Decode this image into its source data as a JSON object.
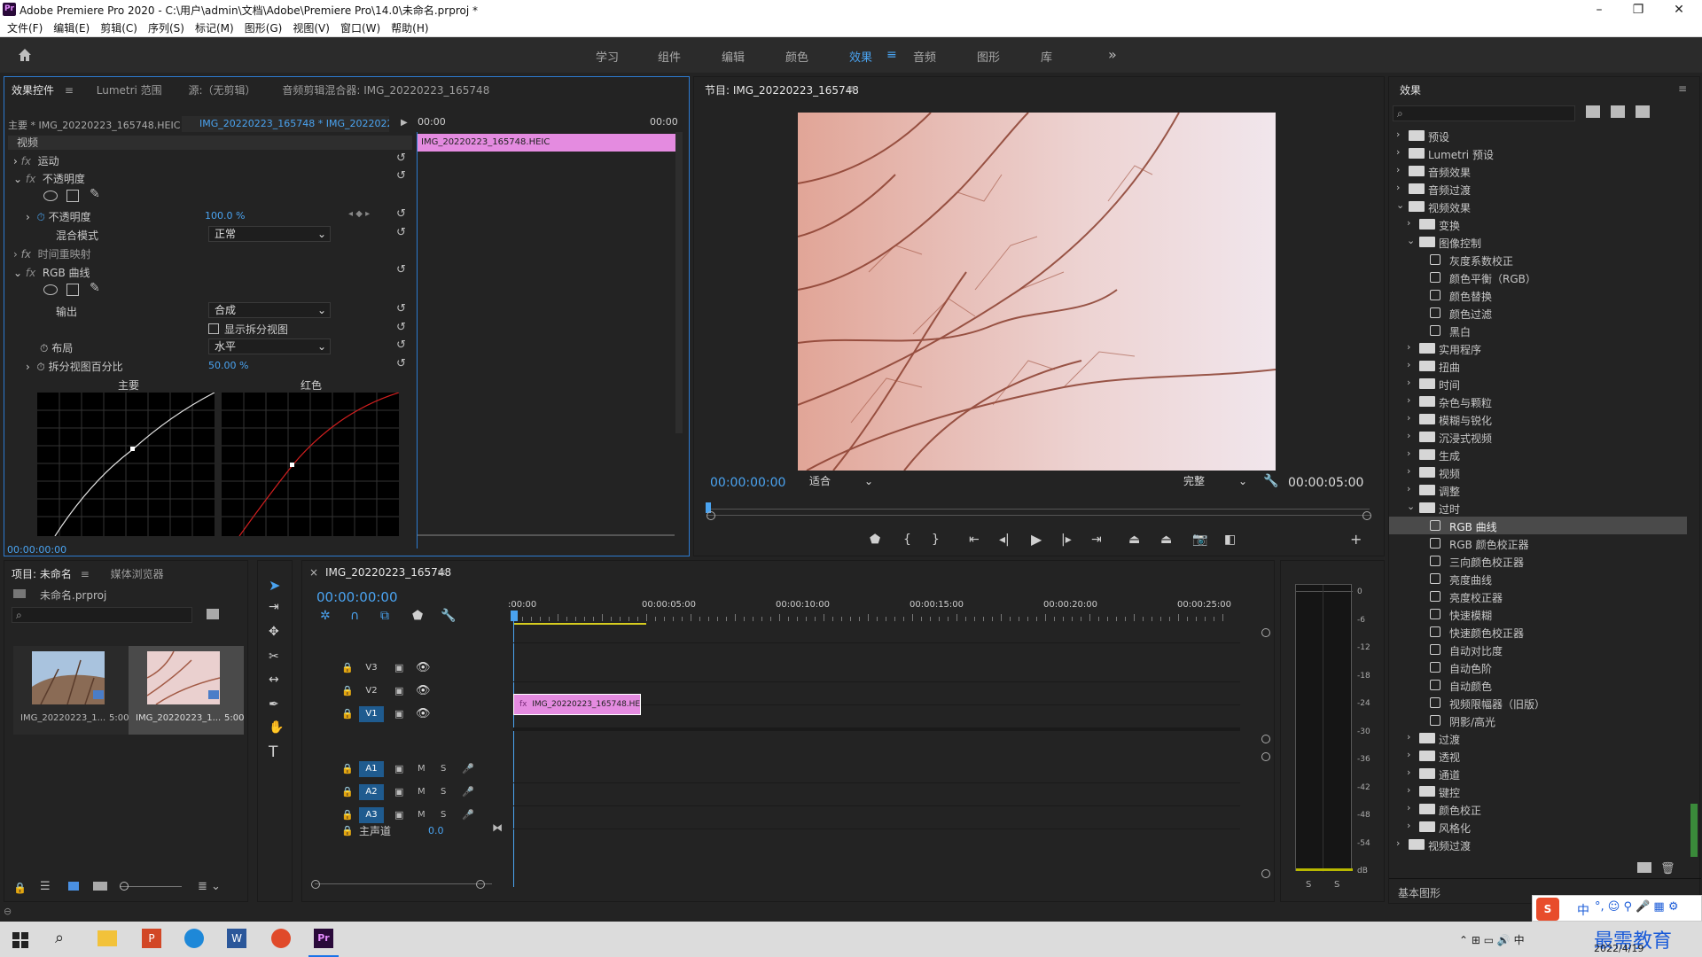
{
  "window": {
    "title": "Adobe Premiere Pro 2020 - C:\\用户\\admin\\文档\\Adobe\\Premiere Pro\\14.0\\未命名.prproj *"
  },
  "menu": [
    "文件(F)",
    "编辑(E)",
    "剪辑(C)",
    "序列(S)",
    "标记(M)",
    "图形(G)",
    "视图(V)",
    "窗口(W)",
    "帮助(H)"
  ],
  "workspaces": [
    "学习",
    "组件",
    "编辑",
    "颜色",
    "效果",
    "音频",
    "图形",
    "库"
  ],
  "workspace_active": "效果",
  "ec": {
    "tabs": [
      "效果控件",
      "Lumetri 范围",
      "源:（无剪辑）",
      "音频剪辑混合器: IMG_20220223_165748"
    ],
    "master_clip": "主要 * IMG_20220223_165748.HEIC",
    "seq_clip": "IMG_20220223_165748 * IMG_2022022...",
    "section": "视频",
    "motion": "运动",
    "opacity": "不透明度",
    "opacity_label": "不透明度",
    "opacity_value": "100.0 %",
    "blend_label": "混合模式",
    "blend_value": "正常",
    "time_remap": "时间重映射",
    "rgb_curves": "RGB 曲线",
    "output_label": "输出",
    "output_value": "合成",
    "split_label": "显示拆分视图",
    "layout_label": "布局",
    "layout_value": "水平",
    "split_pct_label": "拆分视图百分比",
    "split_pct_value": "50.00 %",
    "curve_master": "主要",
    "curve_red": "红色",
    "time_start": "00:00",
    "time_end": "00:00",
    "clip_bar": "IMG_20220223_165748.HEIC",
    "timecode": "00:00:00:00"
  },
  "program": {
    "title": "节目: IMG_20220223_165748",
    "timecode": "00:00:00:00",
    "fit": "适合",
    "quality": "完整",
    "duration": "00:00:05:00"
  },
  "effects": {
    "title": "效果",
    "search_placeholder": "",
    "items": [
      {
        "label": "预设",
        "level": 0,
        "type": "folder"
      },
      {
        "label": "Lumetri 预设",
        "level": 0,
        "type": "folder"
      },
      {
        "label": "音频效果",
        "level": 0,
        "type": "folder"
      },
      {
        "label": "音频过渡",
        "level": 0,
        "type": "folder"
      },
      {
        "label": "视频效果",
        "level": 0,
        "type": "folder-open"
      },
      {
        "label": "变换",
        "level": 1,
        "type": "folder"
      },
      {
        "label": "图像控制",
        "level": 1,
        "type": "folder-open"
      },
      {
        "label": "灰度系数校正",
        "level": 2,
        "type": "fx"
      },
      {
        "label": "颜色平衡（RGB）",
        "level": 2,
        "type": "fx"
      },
      {
        "label": "颜色替换",
        "level": 2,
        "type": "fx"
      },
      {
        "label": "颜色过滤",
        "level": 2,
        "type": "fx"
      },
      {
        "label": "黑白",
        "level": 2,
        "type": "fx"
      },
      {
        "label": "实用程序",
        "level": 1,
        "type": "folder"
      },
      {
        "label": "扭曲",
        "level": 1,
        "type": "folder"
      },
      {
        "label": "时间",
        "level": 1,
        "type": "folder"
      },
      {
        "label": "杂色与颗粒",
        "level": 1,
        "type": "folder"
      },
      {
        "label": "模糊与锐化",
        "level": 1,
        "type": "folder"
      },
      {
        "label": "沉浸式视频",
        "level": 1,
        "type": "folder"
      },
      {
        "label": "生成",
        "level": 1,
        "type": "folder"
      },
      {
        "label": "视频",
        "level": 1,
        "type": "folder"
      },
      {
        "label": "调整",
        "level": 1,
        "type": "folder"
      },
      {
        "label": "过时",
        "level": 1,
        "type": "folder-open"
      },
      {
        "label": "RGB 曲线",
        "level": 2,
        "type": "fx",
        "selected": true
      },
      {
        "label": "RGB 颜色校正器",
        "level": 2,
        "type": "fx"
      },
      {
        "label": "三向颜色校正器",
        "level": 2,
        "type": "fx"
      },
      {
        "label": "亮度曲线",
        "level": 2,
        "type": "fx"
      },
      {
        "label": "亮度校正器",
        "level": 2,
        "type": "fx"
      },
      {
        "label": "快速模糊",
        "level": 2,
        "type": "fx"
      },
      {
        "label": "快速颜色校正器",
        "level": 2,
        "type": "fx"
      },
      {
        "label": "自动对比度",
        "level": 2,
        "type": "fx"
      },
      {
        "label": "自动色阶",
        "level": 2,
        "type": "fx"
      },
      {
        "label": "自动颜色",
        "level": 2,
        "type": "fx"
      },
      {
        "label": "视频限幅器（旧版）",
        "level": 2,
        "type": "fx"
      },
      {
        "label": "阴影/高光",
        "level": 2,
        "type": "fx"
      },
      {
        "label": "过渡",
        "level": 1,
        "type": "folder"
      },
      {
        "label": "透视",
        "level": 1,
        "type": "folder"
      },
      {
        "label": "通道",
        "level": 1,
        "type": "folder"
      },
      {
        "label": "键控",
        "level": 1,
        "type": "folder"
      },
      {
        "label": "颜色校正",
        "level": 1,
        "type": "folder"
      },
      {
        "label": "风格化",
        "level": 1,
        "type": "folder"
      },
      {
        "label": "视频过渡",
        "level": 0,
        "type": "folder"
      }
    ],
    "basic_graphics": "基本图形"
  },
  "project": {
    "tabs": [
      "项目: 未命名",
      "媒体浏览器"
    ],
    "file": "未命名.prproj",
    "items": [
      {
        "name": "IMG_20220223_1...",
        "dur": "5:00"
      },
      {
        "name": "IMG_20220223_1...",
        "dur": "5:00"
      }
    ]
  },
  "timeline": {
    "title": "IMG_20220223_165748",
    "timecode": "00:00:00:00",
    "ruler": [
      ":00:00",
      "00:00:05:00",
      "00:00:10:00",
      "00:00:15:00",
      "00:00:20:00",
      "00:00:25:00"
    ],
    "video_tracks": [
      "V3",
      "V2",
      "V1"
    ],
    "audio_tracks": [
      "A1",
      "A2",
      "A3"
    ],
    "master": "主声道",
    "master_val": "0.0",
    "clip": "IMG_20220223_165748.HEI",
    "ms": [
      "M",
      "S"
    ]
  },
  "meter": {
    "scale": [
      "0",
      "-6",
      "-12",
      "-18",
      "-24",
      "-30",
      "-36",
      "-42",
      "-48",
      "-54",
      "dB"
    ],
    "solo": [
      "S",
      "S"
    ]
  },
  "taskbar": {
    "date": "2022/4/19",
    "ime": "中",
    "watermark": "最需教育"
  }
}
